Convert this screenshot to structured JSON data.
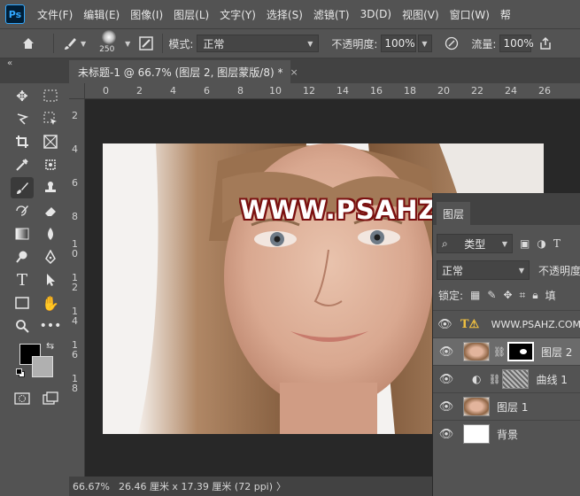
{
  "app": {
    "logo": "Ps"
  },
  "menu": [
    "文件(F)",
    "编辑(E)",
    "图像(I)",
    "图层(L)",
    "文字(Y)",
    "选择(S)",
    "滤镜(T)",
    "3D(D)",
    "视图(V)",
    "窗口(W)",
    "帮"
  ],
  "options": {
    "brush_size": "250",
    "mode_label": "模式:",
    "mode_value": "正常",
    "opacity_label": "不透明度:",
    "opacity_value": "100%",
    "flow_label": "流量:",
    "flow_value": "100%"
  },
  "tab": {
    "collapse": "«",
    "title": "未标题-1 @ 66.7% (图层 2, 图层蒙版/8) *",
    "close": "×"
  },
  "ruler": {
    "h": [
      "0",
      "2",
      "4",
      "6",
      "8",
      "10",
      "12",
      "14",
      "16",
      "18",
      "20",
      "22",
      "24",
      "26"
    ],
    "v": [
      "2",
      "4",
      "6",
      "8",
      "1\n0",
      "1\n2",
      "1\n4",
      "1\n6",
      "1\n8"
    ]
  },
  "canvas": {
    "watermark": "WWW.PSAHZ.COM"
  },
  "status": {
    "zoom": "66.67%",
    "info": "26.46 厘米 x 17.39 厘米 (72 ppi)",
    "arrow": "〉"
  },
  "layers_panel": {
    "tab": "图层",
    "filter_value": "类型",
    "blend_value": "正常",
    "opacity_label": "不透明度",
    "lock_label": "锁定:",
    "fill_label": "填",
    "layers": [
      {
        "name": "WWW.PSAHZ.COM",
        "kind": "text",
        "selected": false
      },
      {
        "name": "图层 2",
        "kind": "mask",
        "selected": true
      },
      {
        "name": "曲线 1",
        "kind": "adjustment",
        "selected": false
      },
      {
        "name": "图层 1",
        "kind": "photo",
        "selected": false
      },
      {
        "name": "背景",
        "kind": "background",
        "selected": false
      }
    ]
  },
  "colors": {
    "foreground": "#000000",
    "background": "#b0b0b0",
    "accent": "#31a8ff"
  }
}
